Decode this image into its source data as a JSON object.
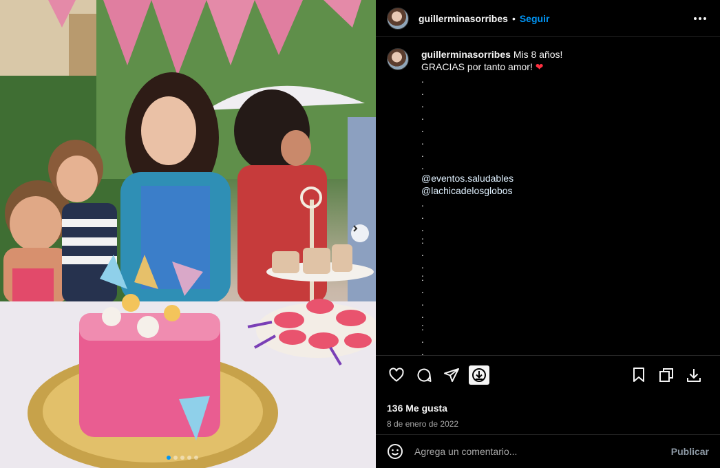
{
  "post": {
    "username": "guillerminasorribes",
    "separator": "•",
    "follow_label": "Seguir",
    "more_icon": "more-horizontal-icon",
    "caption_user": "guillerminasorribes",
    "caption_title": "Mis 8 años!",
    "caption_lines": [
      "GRACIAS por tanto amor! ❤",
      ".",
      ".",
      ".",
      ".",
      ".",
      ".",
      ".",
      ".",
      "@eventos.saludables",
      "@lachicadelosglobos",
      ".",
      ".",
      ".",
      ":",
      ".",
      ".",
      ":",
      ".",
      ".",
      ".",
      ":",
      ".",
      ".",
      ".",
      ":"
    ],
    "likes": "136 Me gusta",
    "date": "8 de enero de 2022",
    "comment_placeholder": "Agrega un comentario...",
    "publish_label": "Publicar",
    "carousel": {
      "slides": 5,
      "active_index": 0
    },
    "icons": {
      "like": "heart-icon",
      "comment": "comment-icon",
      "share": "share-icon",
      "download_tag": "download-badge-icon",
      "save": "bookmark-icon",
      "copy": "copy-icon",
      "download": "download-icon",
      "emoji": "emoji-icon",
      "next": "chevron-right-icon"
    },
    "colors": {
      "accent": "#0095f6",
      "heart": "#ff3040",
      "background": "#000000"
    }
  }
}
